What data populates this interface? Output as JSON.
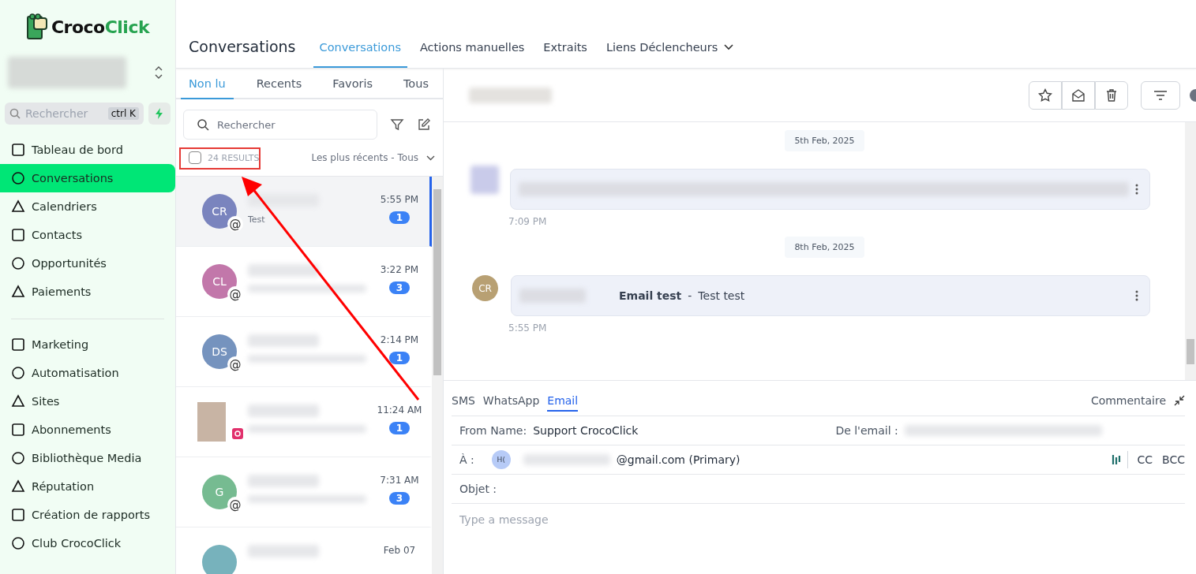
{
  "sidebar": {
    "logo": {
      "part1": "Croco",
      "part2": "Click"
    },
    "search": {
      "placeholder": "Rechercher",
      "shortcut": "ctrl K"
    },
    "groups": [
      [
        {
          "label": "Tableau de bord",
          "selected": false
        },
        {
          "label": "Conversations",
          "selected": true
        },
        {
          "label": "Calendriers",
          "selected": false
        },
        {
          "label": "Contacts",
          "selected": false
        },
        {
          "label": "Opportunités",
          "selected": false
        },
        {
          "label": "Paiements",
          "selected": false
        }
      ],
      [
        {
          "label": "Marketing",
          "selected": false
        },
        {
          "label": "Automatisation",
          "selected": false
        },
        {
          "label": "Sites",
          "selected": false
        },
        {
          "label": "Abonnements",
          "selected": false
        },
        {
          "label": "Bibliothèque Media",
          "selected": false
        },
        {
          "label": "Réputation",
          "selected": false
        },
        {
          "label": "Création de rapports",
          "selected": false
        },
        {
          "label": "Club CrocoClick",
          "selected": false
        }
      ]
    ]
  },
  "header": {
    "title": "Conversations",
    "tabs": [
      {
        "label": "Conversations",
        "selected": true
      },
      {
        "label": "Actions manuelles",
        "selected": false
      },
      {
        "label": "Extraits",
        "selected": false
      },
      {
        "label": "Liens Déclencheurs",
        "selected": false
      }
    ]
  },
  "list": {
    "filters": [
      {
        "label": "Non lu",
        "selected": true
      },
      {
        "label": "Recents",
        "selected": false
      },
      {
        "label": "Favoris",
        "selected": false
      },
      {
        "label": "Tous",
        "selected": false
      }
    ],
    "search": {
      "placeholder": "Rechercher"
    },
    "select_all": {
      "checked": false,
      "label": "24 RESULTS"
    },
    "sort": "Les plus récents - Tous",
    "items": [
      {
        "kind": "initials",
        "initials": "CR",
        "color": "#7a84be",
        "badge": "@",
        "preview": "Test",
        "time": "5:55 PM",
        "count": "1",
        "selected": true
      },
      {
        "kind": "initials",
        "initials": "CL",
        "color": "#c277aa",
        "badge": "@",
        "time": "3:22 PM",
        "count": "3",
        "selected": false
      },
      {
        "kind": "initials",
        "initials": "DS",
        "color": "#7593be",
        "badge": "@",
        "time": "2:14 PM",
        "count": "1",
        "selected": false
      },
      {
        "kind": "photo",
        "time": "11:24 AM",
        "count": "1",
        "selected": false
      },
      {
        "kind": "initials",
        "initials": "G",
        "color": "#76bb91",
        "badge": "@",
        "time": "7:31 AM",
        "count": "3",
        "selected": false
      },
      {
        "kind": "initials",
        "color": "#77b2bc",
        "time": "Feb 07",
        "selected": false
      }
    ]
  },
  "thread": {
    "messages": [
      {
        "date": "5th Feb, 2025",
        "kind": "blurred",
        "time": "7:09 PM"
      },
      {
        "date": "8th Feb, 2025",
        "kind": "email",
        "initials": "CR",
        "subject": "Email test",
        "separator": "-",
        "body": "Test test",
        "time": "5:55 PM"
      }
    ]
  },
  "composer": {
    "channels": [
      {
        "label": "SMS",
        "selected": false
      },
      {
        "label": "WhatsApp",
        "selected": false
      },
      {
        "label": "Email",
        "selected": true
      }
    ],
    "comment": "Commentaire",
    "from_label": "From Name:",
    "from_value": "Support CrocoClick",
    "email_label": "De l'email :",
    "to_label": "À :",
    "to_initials": "H(",
    "to_value": "@gmail.com (Primary)",
    "cc": "CC",
    "bcc": "BCC",
    "subject_label": "Objet :",
    "message": {
      "placeholder": "Type a message"
    }
  }
}
